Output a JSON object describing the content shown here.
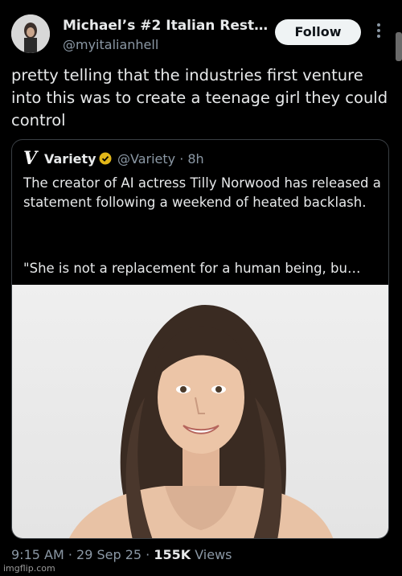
{
  "header": {
    "name": "Michael’s #2 Italian Rest…",
    "handle": "@myitalianhell",
    "follow_label": "Follow"
  },
  "tweet": {
    "text": "pretty telling that the industries first venture into this was to create a teenage girl they could control"
  },
  "quote": {
    "logo": "V",
    "name": "Variety",
    "handle_time": "@Variety · 8h",
    "text": "The creator of AI actress Tilly Norwood has released a statement following a weekend of heated backlash.",
    "text2": "\"She is not a replacement for a human being, bu…",
    "verified_color": "#e2b719"
  },
  "meta": {
    "time_date": "9:15 AM · 29 Sep 25 · ",
    "views_count": "155K",
    "views_label": " Views"
  },
  "watermark": "imgflip.com"
}
